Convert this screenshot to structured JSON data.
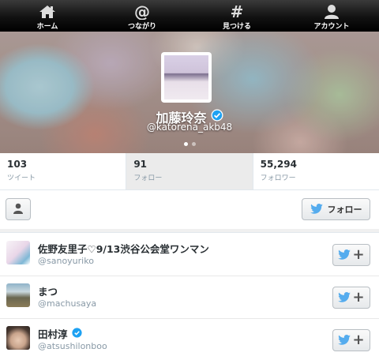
{
  "tabbar": {
    "items": [
      {
        "label": "ホーム",
        "icon": "home-icon"
      },
      {
        "label": "つながり",
        "icon": "at-icon"
      },
      {
        "label": "見つける",
        "icon": "hashtag-icon"
      },
      {
        "label": "アカウント",
        "icon": "account-icon"
      }
    ]
  },
  "profile": {
    "name": "加藤玲奈",
    "handle": "@katorena_akb48",
    "verified": true
  },
  "stats": [
    {
      "value": "103",
      "caption": "ツイート"
    },
    {
      "value": "91",
      "caption": "フォロー"
    },
    {
      "value": "55,294",
      "caption": "フォロワー"
    }
  ],
  "actions": {
    "follow_label": "フォロー"
  },
  "users": [
    {
      "name": "佐野友里子♡9/13渋谷公会堂ワンマン",
      "handle": "@sanoyuriko",
      "verified": false
    },
    {
      "name": "まつ",
      "handle": "@machusaya",
      "verified": false
    },
    {
      "name": "田村淳",
      "handle": "@atsushilonboo",
      "verified": true
    }
  ],
  "colors": {
    "twitter_blue": "#55acee",
    "verified_blue": "#1da1f2"
  }
}
